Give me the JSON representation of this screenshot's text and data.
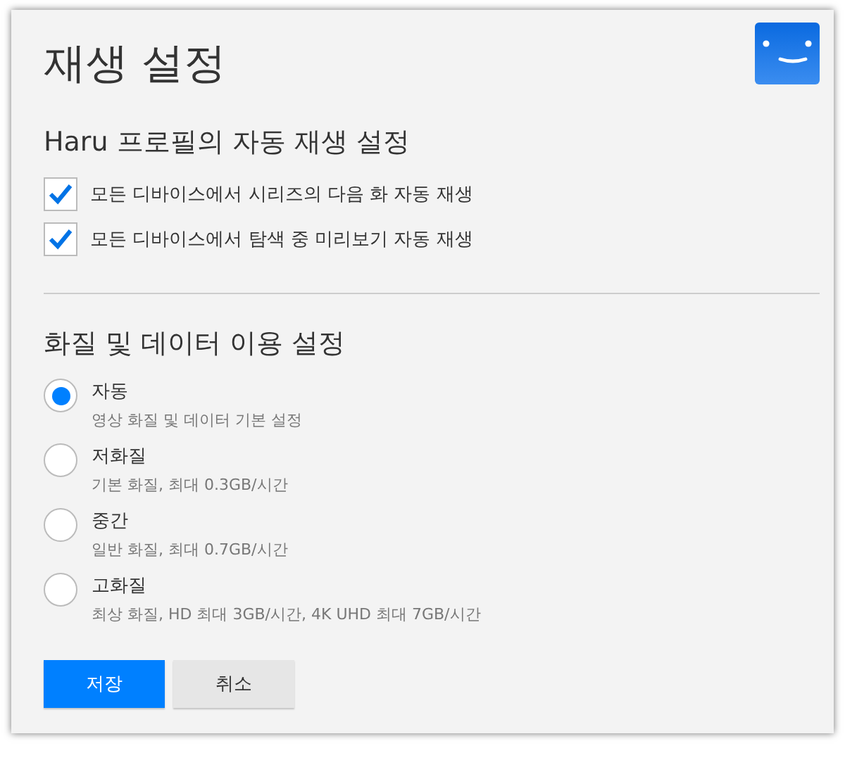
{
  "title": "재생 설정",
  "autoplay": {
    "heading": "Haru 프로필의 자동 재생 설정",
    "options": [
      {
        "label": "모든 디바이스에서 시리즈의 다음 화 자동 재생",
        "checked": true
      },
      {
        "label": "모든 디바이스에서 탐색 중 미리보기 자동 재생",
        "checked": true
      }
    ]
  },
  "quality": {
    "heading": "화질 및 데이터 이용 설정",
    "options": [
      {
        "label": "자동",
        "description": "영상 화질 및 데이터 기본 설정",
        "selected": true
      },
      {
        "label": "저화질",
        "description": "기본 화질, 최대 0.3GB/시간",
        "selected": false
      },
      {
        "label": "중간",
        "description": "일반 화질, 최대 0.7GB/시간",
        "selected": false
      },
      {
        "label": "고화질",
        "description": "최상 화질, HD 최대 3GB/시간, 4K UHD 최대 7GB/시간",
        "selected": false
      }
    ]
  },
  "buttons": [
    {
      "label": "저장",
      "kind": "primary"
    },
    {
      "label": "취소",
      "kind": "secondary"
    }
  ]
}
